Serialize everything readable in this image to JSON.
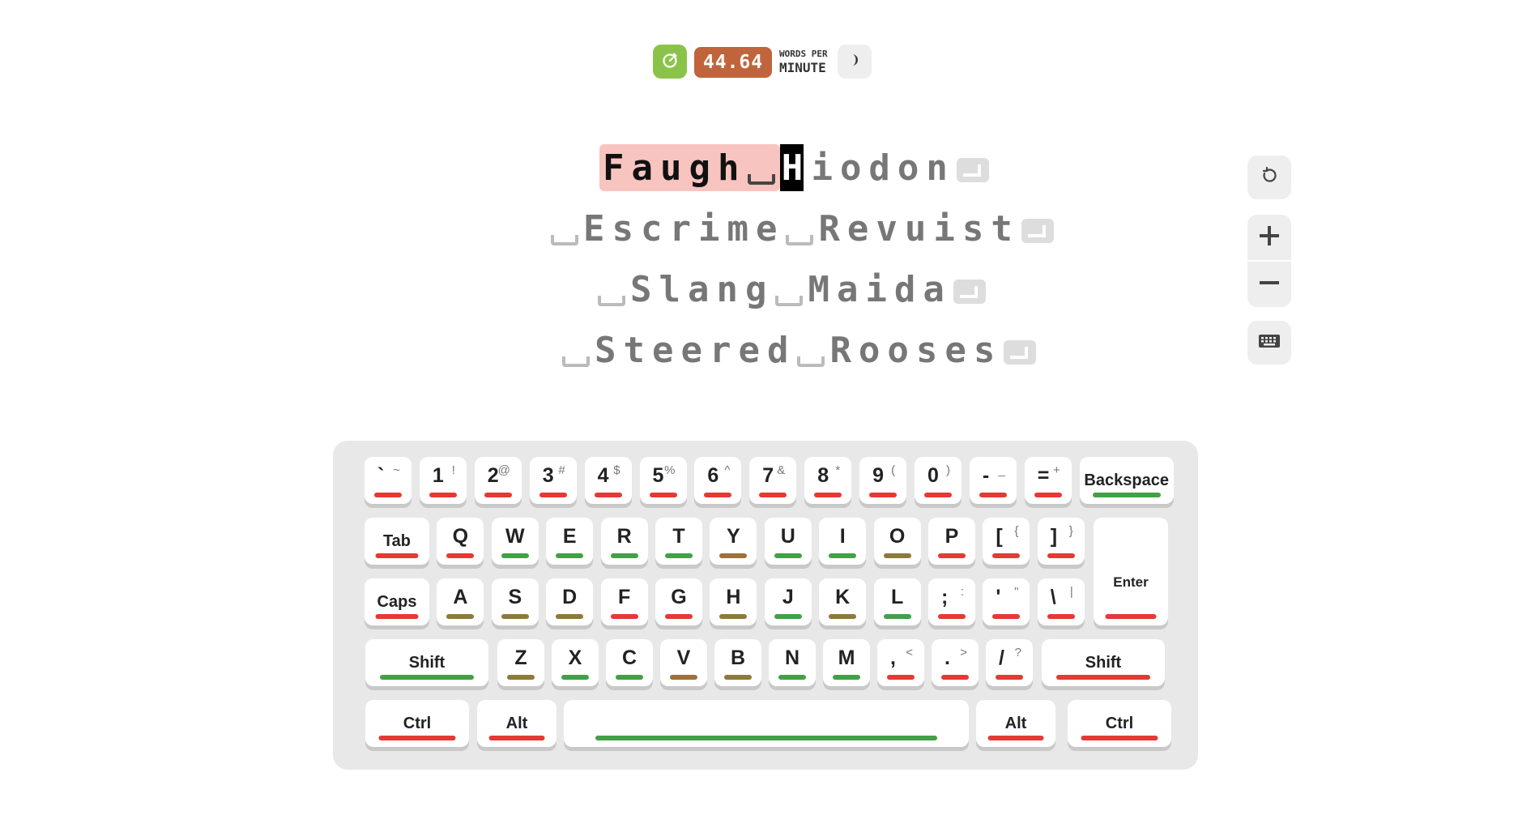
{
  "colors": {
    "red": "#e53935",
    "green": "#43a047",
    "olive": "#8d7a3a",
    "brown": "#a0703a"
  },
  "topbar": {
    "timer_icon": "timer-icon",
    "wpm_value": "44.64",
    "wpm_label_top": "WORDS PER",
    "wpm_label_bottom": "MINUTE",
    "theme_icon": "half-moon-icon"
  },
  "text": {
    "lines": [
      {
        "typed": "Faugh",
        "typed_space": true,
        "cursor": "H",
        "rest": "iodon",
        "words": [
          "Faugh",
          "Hiodon"
        ]
      },
      {
        "words": [
          "Escrime",
          "Revuist"
        ]
      },
      {
        "words": [
          "Slang",
          "Maida"
        ]
      },
      {
        "words": [
          "Steered",
          "Rooses"
        ]
      }
    ]
  },
  "side_controls": {
    "reset_icon": "reset-icon",
    "zoom_in_icon": "plus-icon",
    "zoom_out_icon": "minus-icon",
    "keyboard_icon": "keyboard-icon"
  },
  "keyboard": {
    "rows": [
      [
        {
          "main": "`",
          "alt": "~",
          "color": "red"
        },
        {
          "main": "1",
          "alt": "!",
          "color": "red"
        },
        {
          "main": "2",
          "alt": "@",
          "color": "red"
        },
        {
          "main": "3",
          "alt": "#",
          "color": "red"
        },
        {
          "main": "4",
          "alt": "$",
          "color": "red"
        },
        {
          "main": "5",
          "alt": "%",
          "color": "red"
        },
        {
          "main": "6",
          "alt": "^",
          "color": "red"
        },
        {
          "main": "7",
          "alt": "&",
          "color": "red"
        },
        {
          "main": "8",
          "alt": "*",
          "color": "red"
        },
        {
          "main": "9",
          "alt": "(",
          "color": "red"
        },
        {
          "main": "0",
          "alt": ")",
          "color": "red"
        },
        {
          "main": "-",
          "alt": "_",
          "color": "red"
        },
        {
          "main": "=",
          "alt": "+",
          "color": "red"
        },
        {
          "label": "Backspace",
          "color": "green"
        }
      ],
      [
        {
          "label": "Tab",
          "color": "red"
        },
        {
          "main": "Q",
          "color": "red"
        },
        {
          "main": "W",
          "color": "green"
        },
        {
          "main": "E",
          "color": "green"
        },
        {
          "main": "R",
          "color": "green"
        },
        {
          "main": "T",
          "color": "green"
        },
        {
          "main": "Y",
          "color": "brown"
        },
        {
          "main": "U",
          "color": "green"
        },
        {
          "main": "I",
          "color": "green"
        },
        {
          "main": "O",
          "color": "olive"
        },
        {
          "main": "P",
          "color": "red"
        },
        {
          "main": "[",
          "alt": "{",
          "color": "red"
        },
        {
          "main": "]",
          "alt": "}",
          "color": "red"
        },
        {
          "label": "Enter",
          "color": "red"
        }
      ],
      [
        {
          "label": "Caps",
          "color": "red"
        },
        {
          "main": "A",
          "color": "olive"
        },
        {
          "main": "S",
          "color": "olive"
        },
        {
          "main": "D",
          "color": "olive"
        },
        {
          "main": "F",
          "color": "red"
        },
        {
          "main": "G",
          "color": "red"
        },
        {
          "main": "H",
          "color": "olive"
        },
        {
          "main": "J",
          "color": "green"
        },
        {
          "main": "K",
          "color": "olive"
        },
        {
          "main": "L",
          "color": "green"
        },
        {
          "main": ";",
          "alt": ":",
          "color": "red"
        },
        {
          "main": "'",
          "alt": "\"",
          "color": "red"
        },
        {
          "main": "\\",
          "alt": "|",
          "color": "red"
        }
      ],
      [
        {
          "label": "Shift",
          "color": "green"
        },
        {
          "main": "Z",
          "color": "olive"
        },
        {
          "main": "X",
          "color": "green"
        },
        {
          "main": "C",
          "color": "green"
        },
        {
          "main": "V",
          "color": "brown"
        },
        {
          "main": "B",
          "color": "olive"
        },
        {
          "main": "N",
          "color": "green"
        },
        {
          "main": "M",
          "color": "green"
        },
        {
          "main": ",",
          "alt": "<",
          "color": "red"
        },
        {
          "main": ".",
          "alt": ">",
          "color": "red"
        },
        {
          "main": "/",
          "alt": "?",
          "color": "red"
        },
        {
          "label": "Shift",
          "color": "red"
        }
      ],
      [
        {
          "label": "Ctrl",
          "color": "red"
        },
        {
          "label": "Alt",
          "color": "red"
        },
        {
          "label": "",
          "color": "green"
        },
        {
          "label": "Alt",
          "color": "red"
        },
        {
          "label": "Ctrl",
          "color": "red"
        }
      ]
    ]
  }
}
